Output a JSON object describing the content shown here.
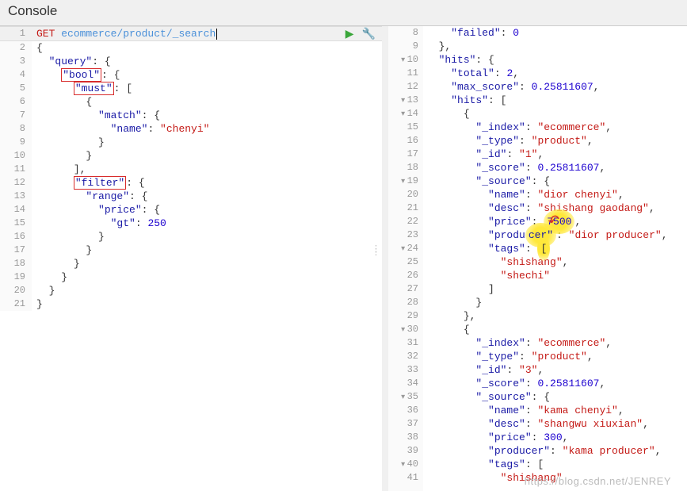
{
  "header": {
    "title": "Console"
  },
  "request": {
    "method": "GET",
    "path": "ecommerce/product/_search",
    "body_lines": [
      {
        "n": 1,
        "method": "GET",
        "path": "ecommerce/product/_search"
      },
      {
        "n": 2,
        "text": "{"
      },
      {
        "n": 3,
        "indent": 1,
        "key": "query",
        "after": ": {"
      },
      {
        "n": 4,
        "indent": 2,
        "key": "bool",
        "after": ": {",
        "box": true
      },
      {
        "n": 5,
        "indent": 3,
        "key": "must",
        "after": ": [",
        "box": true
      },
      {
        "n": 6,
        "indent": 4,
        "text": "{"
      },
      {
        "n": 7,
        "indent": 5,
        "key": "match",
        "after": ": {"
      },
      {
        "n": 8,
        "indent": 6,
        "key": "name",
        "after": ": ",
        "str": "chenyi"
      },
      {
        "n": 9,
        "indent": 5,
        "text": "}"
      },
      {
        "n": 10,
        "indent": 4,
        "text": "}"
      },
      {
        "n": 11,
        "indent": 3,
        "text": "],"
      },
      {
        "n": 12,
        "indent": 3,
        "key": "filter",
        "after": ": {",
        "box": true
      },
      {
        "n": 13,
        "indent": 4,
        "key": "range",
        "after": ": {"
      },
      {
        "n": 14,
        "indent": 5,
        "key": "price",
        "after": ": {"
      },
      {
        "n": 15,
        "indent": 6,
        "key": "gt",
        "after": ": ",
        "num": "250"
      },
      {
        "n": 16,
        "indent": 5,
        "text": "}"
      },
      {
        "n": 17,
        "indent": 4,
        "text": "}"
      },
      {
        "n": 18,
        "indent": 3,
        "text": "}"
      },
      {
        "n": 19,
        "indent": 2,
        "text": "}"
      },
      {
        "n": 20,
        "indent": 1,
        "text": "}"
      },
      {
        "n": 21,
        "text": "}"
      }
    ]
  },
  "response": {
    "lines": [
      {
        "n": 8,
        "i": 2,
        "key": "failed",
        "after": ": ",
        "num": "0"
      },
      {
        "n": 9,
        "i": 1,
        "text": "},"
      },
      {
        "n": 10,
        "i": 1,
        "key": "hits",
        "after": ": {",
        "fold": true
      },
      {
        "n": 11,
        "i": 2,
        "key": "total",
        "after": ": ",
        "num": "2",
        "comma": true
      },
      {
        "n": 12,
        "i": 2,
        "key": "max_score",
        "after": ": ",
        "num": "0.25811607",
        "comma": true
      },
      {
        "n": 13,
        "i": 2,
        "key": "hits",
        "after": ": [",
        "fold": true
      },
      {
        "n": 14,
        "i": 3,
        "text": "{",
        "fold": true
      },
      {
        "n": 15,
        "i": 4,
        "key": "_index",
        "after": ": ",
        "str": "ecommerce",
        "comma": true
      },
      {
        "n": 16,
        "i": 4,
        "key": "_type",
        "after": ": ",
        "str": "product",
        "comma": true
      },
      {
        "n": 17,
        "i": 4,
        "key": "_id",
        "after": ": ",
        "str": "1",
        "comma": true
      },
      {
        "n": 18,
        "i": 4,
        "key": "_score",
        "after": ": ",
        "num": "0.25811607",
        "comma": true
      },
      {
        "n": 19,
        "i": 4,
        "key": "_source",
        "after": ": {",
        "fold": true
      },
      {
        "n": 20,
        "i": 5,
        "key": "name",
        "after": ": ",
        "str": "dior chenyi",
        "comma": true
      },
      {
        "n": 21,
        "i": 5,
        "key": "desc",
        "after": ": ",
        "str": "shishang gaodang",
        "comma": true
      },
      {
        "n": 22,
        "i": 5,
        "key": "price",
        "after": ": ",
        "num": "7500",
        "comma": true,
        "highlight": true
      },
      {
        "n": 23,
        "i": 5,
        "key": "producer",
        "after": ": ",
        "str": "dior producer",
        "comma": true,
        "hlkey": true
      },
      {
        "n": 24,
        "i": 5,
        "key": "tags",
        "after": ": [",
        "fold": true,
        "hlkey2": true
      },
      {
        "n": 25,
        "i": 6,
        "str": "shishang",
        "comma": true,
        "plain": true
      },
      {
        "n": 26,
        "i": 6,
        "str": "shechi",
        "plain": true
      },
      {
        "n": 27,
        "i": 5,
        "text": "]"
      },
      {
        "n": 28,
        "i": 4,
        "text": "}"
      },
      {
        "n": 29,
        "i": 3,
        "text": "},"
      },
      {
        "n": 30,
        "i": 3,
        "text": "{",
        "fold": true
      },
      {
        "n": 31,
        "i": 4,
        "key": "_index",
        "after": ": ",
        "str": "ecommerce",
        "comma": true
      },
      {
        "n": 32,
        "i": 4,
        "key": "_type",
        "after": ": ",
        "str": "product",
        "comma": true
      },
      {
        "n": 33,
        "i": 4,
        "key": "_id",
        "after": ": ",
        "str": "3",
        "comma": true
      },
      {
        "n": 34,
        "i": 4,
        "key": "_score",
        "after": ": ",
        "num": "0.25811607",
        "comma": true
      },
      {
        "n": 35,
        "i": 4,
        "key": "_source",
        "after": ": {",
        "fold": true
      },
      {
        "n": 36,
        "i": 5,
        "key": "name",
        "after": ": ",
        "str": "kama chenyi",
        "comma": true
      },
      {
        "n": 37,
        "i": 5,
        "key": "desc",
        "after": ": ",
        "str": "shangwu xiuxian",
        "comma": true
      },
      {
        "n": 38,
        "i": 5,
        "key": "price",
        "after": ": ",
        "num": "300",
        "comma": true
      },
      {
        "n": 39,
        "i": 5,
        "key": "producer",
        "after": ": ",
        "str": "kama producer",
        "comma": true
      },
      {
        "n": 40,
        "i": 5,
        "key": "tags",
        "after": ": [",
        "fold": true
      },
      {
        "n": 41,
        "i": 6,
        "str": "shishang",
        "plain": true,
        "partial": true
      }
    ]
  },
  "watermark": "https://blog.csdn.net/JENREY"
}
